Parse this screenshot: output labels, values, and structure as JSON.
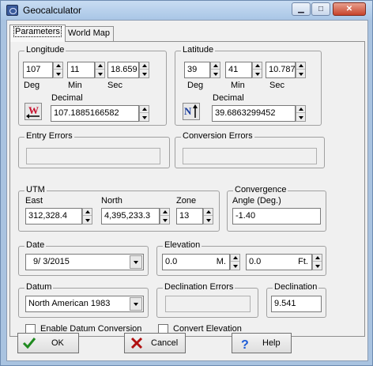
{
  "window": {
    "title": "Geocalculator",
    "controls": {
      "minimize": "▁",
      "maximize": "□",
      "close": "✕"
    }
  },
  "tabs": [
    {
      "label": "Parameters",
      "active": true
    },
    {
      "label": "World Map",
      "active": false
    }
  ],
  "longitude": {
    "group_label": "Longitude",
    "deg": "107",
    "min": "11",
    "sec": "18.659",
    "deg_label": "Deg",
    "min_label": "Min",
    "sec_label": "Sec",
    "decimal_label": "Decimal",
    "decimal": "107.1885166582",
    "direction": "W"
  },
  "latitude": {
    "group_label": "Latitude",
    "deg": "39",
    "min": "41",
    "sec": "10.787",
    "deg_label": "Deg",
    "min_label": "Min",
    "sec_label": "Sec",
    "decimal_label": "Decimal",
    "decimal": "39.6863299452",
    "direction": "N"
  },
  "entry_errors": {
    "label": "Entry Errors",
    "value": ""
  },
  "conversion_errors": {
    "label": "Conversion Errors",
    "value": ""
  },
  "utm": {
    "group_label": "UTM",
    "east_label": "East",
    "east": "312,328.4",
    "north_label": "North",
    "north": "4,395,233.3",
    "zone_label": "Zone",
    "zone": "13"
  },
  "convergence": {
    "group_label": "Convergence",
    "angle_label": "Angle (Deg.)",
    "value": "-1.40"
  },
  "date": {
    "group_label": "Date",
    "value": "9/  3/2015"
  },
  "elevation": {
    "group_label": "Elevation",
    "meters": "0.0",
    "meters_unit": "M.",
    "feet": "0.0",
    "feet_unit": "Ft."
  },
  "datum": {
    "group_label": "Datum",
    "value": "North American 1983"
  },
  "declination_errors": {
    "label": "Declination Errors",
    "value": ""
  },
  "declination": {
    "group_label": "Declination",
    "value": "9.541"
  },
  "options": {
    "enable_datum_conversion": "Enable Datum Conversion",
    "convert_elevation": "Convert Elevation"
  },
  "buttons": {
    "ok": "OK",
    "cancel": "Cancel",
    "help": "Help"
  },
  "colors": {
    "direction_w": "#c8102e",
    "direction_n": "#1a3c9c",
    "ok_green": "#1f8a1f",
    "cancel_red": "#b01010",
    "help_blue": "#1d5bd6"
  }
}
